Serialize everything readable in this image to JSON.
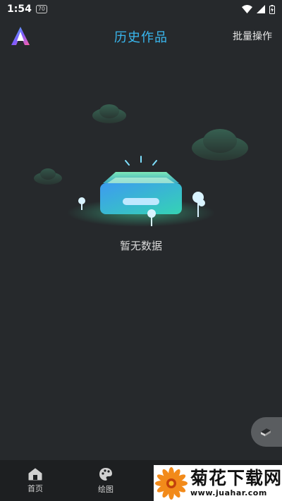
{
  "status_bar": {
    "time": "1:54",
    "badge": "70"
  },
  "header": {
    "title": "历史作品",
    "batch_action": "批量操作"
  },
  "empty_state": {
    "message": "暂无数据"
  },
  "bottom_nav": {
    "items": [
      {
        "label": "首页",
        "icon": "home-icon"
      },
      {
        "label": "绘图",
        "icon": "palette-icon"
      }
    ]
  },
  "watermark": {
    "title": "菊花下载网",
    "url": "www.juahar.com"
  },
  "colors": {
    "background": "#26292c",
    "title_accent": "#39b8f0",
    "nav_background": "#1d1f21"
  }
}
